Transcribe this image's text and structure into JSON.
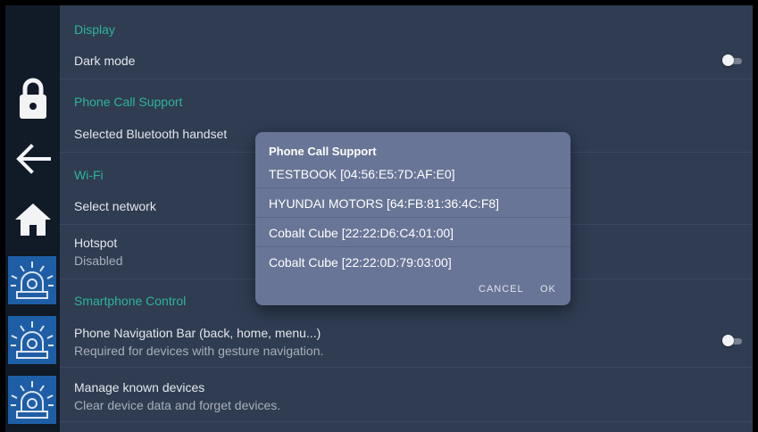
{
  "sidebar": {
    "buttons": [
      "lock-icon",
      "back-arrow-icon",
      "home-icon",
      "alarm-siren-icon",
      "alarm-siren-icon",
      "alarm-siren-icon"
    ]
  },
  "settings": {
    "display": {
      "header": "Display",
      "dark_mode": {
        "title": "Dark mode",
        "enabled": false
      }
    },
    "phone_call_support": {
      "header": "Phone Call Support",
      "selected_handset": {
        "title": "Selected Bluetooth handset"
      }
    },
    "wifi": {
      "header": "Wi-Fi",
      "select_network": {
        "title": "Select network"
      },
      "hotspot": {
        "title": "Hotspot",
        "summary": "Disabled"
      }
    },
    "smartphone_control": {
      "header": "Smartphone Control",
      "nav_bar": {
        "title": "Phone Navigation Bar (back, home, menu...)",
        "summary": "Required for devices with gesture navigation.",
        "enabled": false
      },
      "manage_devices": {
        "title": "Manage known devices",
        "summary": "Clear device data and forget devices."
      }
    }
  },
  "dialog": {
    "title": "Phone Call Support",
    "options": [
      "TESTBOOK [04:56:E5:7D:AF:E0]",
      "HYUNDAI MOTORS [64:FB:81:36:4C:F8]",
      "Cobalt Cube [22:22:D6:C4:01:00]",
      "Cobalt Cube [22:22:0D:79:03:00]"
    ],
    "cancel_label": "CANCEL",
    "ok_label": "OK"
  },
  "colors": {
    "background": "#2f3c52",
    "sidebar": "#111a27",
    "section_header": "#2fb49a",
    "dialog": "#697596",
    "alarm_button": "#1e5ea6"
  }
}
